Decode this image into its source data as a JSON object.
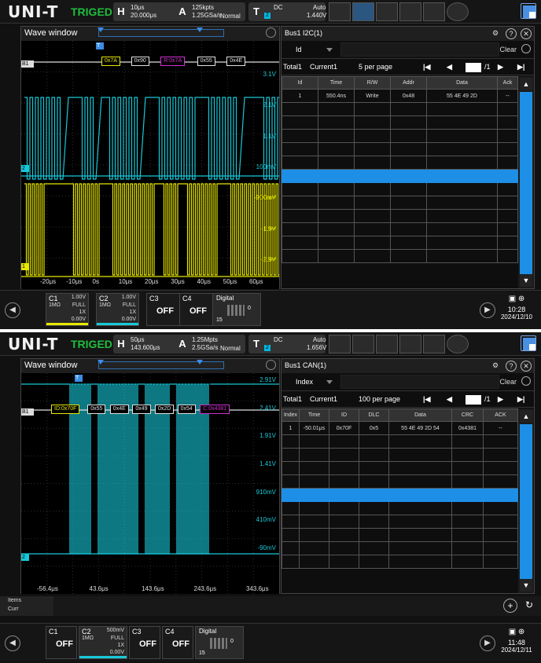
{
  "screens": [
    {
      "logo": "UNI-T",
      "trigger_status": "TRIGED",
      "horizontal": {
        "key": "H",
        "scale": "10μs",
        "offset": "20.000μs"
      },
      "acquire": {
        "key": "A",
        "depth": "125kpts",
        "rate": "1.25GSa/s",
        "mode": "Normal"
      },
      "trigger": {
        "key": "T",
        "source": "2",
        "coupling": "DC",
        "sweep": "Auto",
        "level": "1.440V"
      },
      "wave_window": {
        "title": "Wave window"
      },
      "bus_label": "B1",
      "decode_packets": [
        "0x7A",
        "0x90",
        "R:0x7A",
        "0x55",
        "0x4E"
      ],
      "right_axis": [
        "3.1V",
        "2.1V",
        "1.1V",
        "100mV",
        "-900mV",
        "-1.9V",
        "-2.9V"
      ],
      "time_axis": [
        "-20μs",
        "-10μs",
        "0s",
        "10μs",
        "20μs",
        "30μs",
        "40μs",
        "50μs",
        "60μs"
      ],
      "ch_markers": {
        "t": "T",
        "ch2": "2",
        "ch1": "1"
      },
      "table_panel": {
        "title": "Bus1 I2C(1)",
        "filter_label": "Id",
        "clear_label": "Clear",
        "total": "Total1",
        "current": "Current1",
        "per_page": "5 per page",
        "page_num": "1",
        "page_total": "/1",
        "columns": [
          "Id",
          "Time",
          "R/W",
          "Addr",
          "Data",
          "Ack"
        ],
        "rows": [
          [
            "1",
            "550.4ns",
            "Write",
            "0x48",
            "55 4E 49 2D",
            "--"
          ]
        ]
      },
      "channels": [
        {
          "name": "C1",
          "scale": "1.00V",
          "imp": "1MΩ",
          "bw": "FULL",
          "probe": "1X",
          "offset": "0.00V"
        },
        {
          "name": "C2",
          "scale": "1.00V",
          "imp": "1MΩ",
          "bw": "FULL",
          "probe": "1X",
          "offset": "0.00V"
        },
        {
          "name": "C3",
          "state": "OFF"
        },
        {
          "name": "C4",
          "state": "OFF"
        }
      ],
      "digital": {
        "name": "Digital",
        "count": "0",
        "group": "15"
      },
      "clock": {
        "time": "10:28",
        "date": "2024/12/10"
      }
    },
    {
      "logo": "UNI-T",
      "trigger_status": "TRIGED",
      "horizontal": {
        "key": "H",
        "scale": "50μs",
        "offset": "143.600μs"
      },
      "acquire": {
        "key": "A",
        "depth": "1.25Mpts",
        "rate": "2.5GSa/s",
        "mode": "Normal"
      },
      "trigger": {
        "key": "T",
        "source": "2",
        "coupling": "DC",
        "sweep": "Auto",
        "level": "1.656V"
      },
      "wave_window": {
        "title": "Wave window"
      },
      "bus_label": "B1",
      "decode_packets": [
        "ID:0x70F",
        "0x55",
        "0x4E",
        "0x49",
        "0x2D",
        "0x54",
        "C:0x4381"
      ],
      "right_axis": [
        "2.91V",
        "2.41V",
        "1.91V",
        "1.41V",
        "910mV",
        "410mV",
        "-90mV"
      ],
      "time_axis": [
        "-56.4μs",
        "43.6μs",
        "143.6μs",
        "243.6μs",
        "343.6μs"
      ],
      "ch_markers": {
        "t": "T",
        "ch2": "2"
      },
      "table_panel": {
        "title": "Bus1 CAN(1)",
        "filter_label": "Index",
        "clear_label": "Clear",
        "total": "Total1",
        "current": "Current1",
        "per_page": "100 per page",
        "page_num": "1",
        "page_total": "/1",
        "columns": [
          "Index",
          "Time",
          "ID",
          "DLC",
          "Data",
          "CRC",
          "ACK"
        ],
        "rows": [
          [
            "1",
            "-50.01μs",
            "0x70F",
            "0x5",
            "55 4E 49 2D 54",
            "0x4381",
            "--"
          ]
        ]
      },
      "items": {
        "label": "Items",
        "curr": "Curr"
      },
      "channels": [
        {
          "name": "C1",
          "state": "OFF"
        },
        {
          "name": "C2",
          "scale": "500mV",
          "imp": "1MΩ",
          "bw": "FULL",
          "probe": "1X",
          "offset": "0.00V"
        },
        {
          "name": "C3",
          "state": "OFF"
        },
        {
          "name": "C4",
          "state": "OFF"
        }
      ],
      "digital": {
        "name": "Digital",
        "count": "0",
        "group": "15"
      },
      "clock": {
        "time": "11:48",
        "date": "2024/12/11"
      }
    }
  ],
  "colors": {
    "ch1": "#e8e800",
    "ch2": "#18c8d8",
    "bus": "#e0e0e0",
    "accent": "#1e8fe6",
    "trig": "#1fbd3d",
    "ack_bad": "#d01010"
  }
}
